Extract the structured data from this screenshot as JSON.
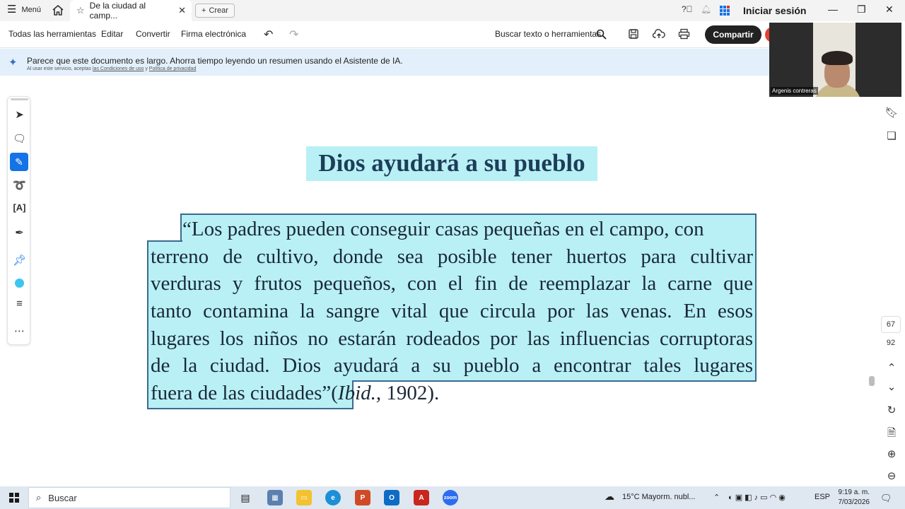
{
  "titlebar": {
    "menu_label": "Menú",
    "tab_title": "De la ciudad al camp...",
    "create_label": "Crear",
    "signin_label": "Iniciar sesión"
  },
  "toolbar": {
    "items": [
      "Todas las herramientas",
      "Editar",
      "Convertir",
      "Firma electrónica"
    ],
    "search_label": "Buscar texto o herramientas",
    "share_label": "Compartir"
  },
  "banner": {
    "message": "Parece que este documento es largo. Ahorra tiempo leyendo un resumen usando el Asistente de IA.",
    "terms_prefix": "Al usar este servicio, aceptas",
    "terms_link": "las Condiciones de uso",
    "terms_and": "y",
    "privacy_link": "Política de privacidad"
  },
  "video": {
    "participant_name": "Argenis contreras"
  },
  "document": {
    "heading": "Dios ayudará a su pueblo",
    "lines": [
      "“Los padres pueden conseguir casas pequeñas en el campo, con",
      "terreno de cultivo, donde sea posible tener huertos para cultivar",
      "verduras y frutos pequeños, con el fin de reemplazar la carne que",
      "tanto contamina la sangre vital que circula por las venas. En esos",
      "lugares los niños no estarán rodeados por las influencias corruptoras",
      "de la ciudad. Dios ayudará a su pueblo a encontrar tales lugares"
    ],
    "last_line_quote": "fuera de las ciudades”",
    "citation_open": "(",
    "citation_italic": "Ibid.,",
    "citation_rest": " 1902)."
  },
  "pagination": {
    "current_page": "67",
    "total_pages": "92"
  },
  "colors": {
    "highlight": "#b8f0f5",
    "highlight_border": "#3b6a8f",
    "accent_blue": "#1473e6",
    "share_button": "#222222",
    "heading_text": "#1d3d58"
  },
  "taskbar": {
    "search_placeholder": "Buscar",
    "apps": [
      "task-view",
      "file-explorer-alt",
      "file-explorer",
      "edge",
      "powerpoint",
      "outlook",
      "acrobat",
      "zoom"
    ],
    "weather": "15°C  Mayorm. nubl...",
    "language": "ESP",
    "time": "9:19 a. m.",
    "date": "7/03/2026"
  }
}
